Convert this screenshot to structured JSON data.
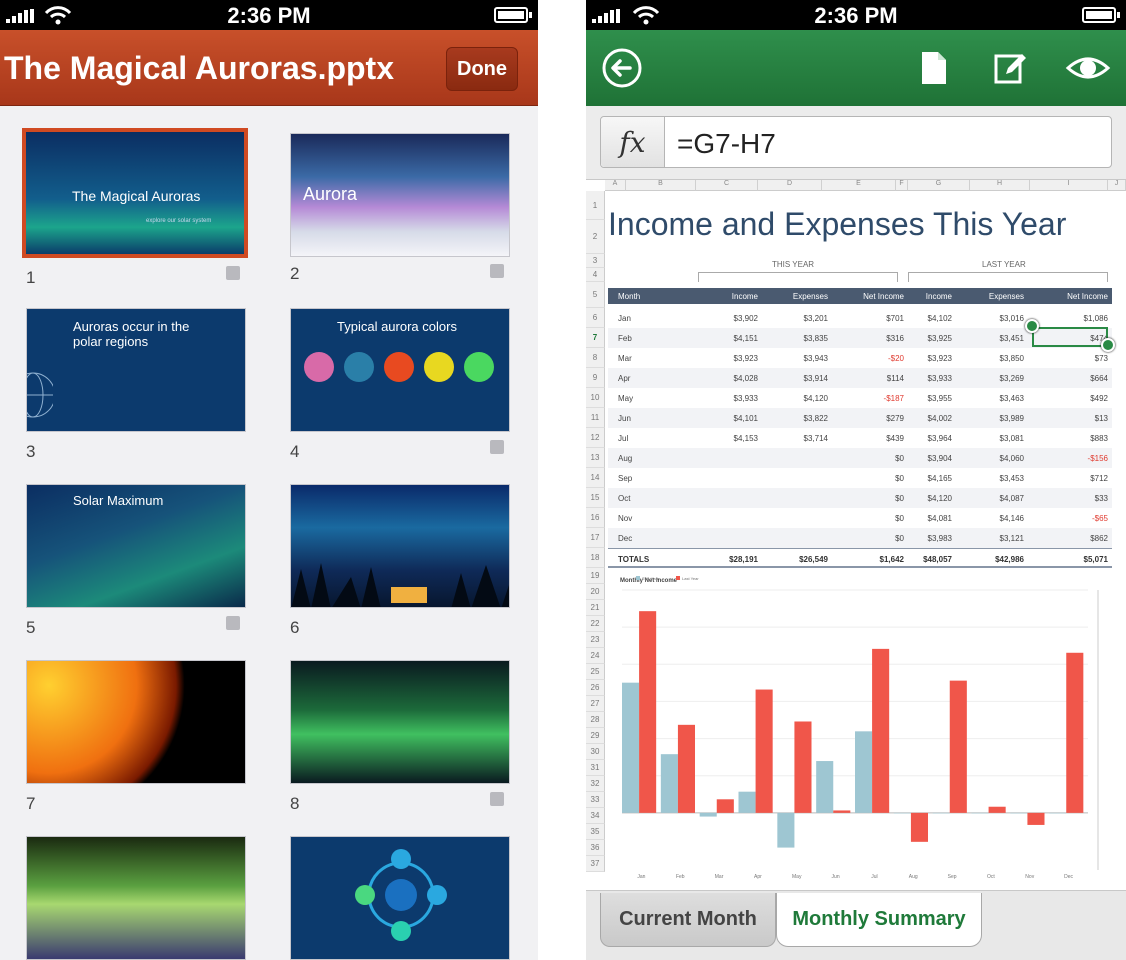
{
  "status": {
    "time": "2:36 PM"
  },
  "ppt": {
    "title": "The Magical Auroras.pptx",
    "done_label": "Done",
    "slides": [
      {
        "num": "1",
        "title": "The Magical Auroras",
        "subtitle": "explore our solar system"
      },
      {
        "num": "2",
        "title": "Aurora"
      },
      {
        "num": "3",
        "title": "Auroras occur in the polar regions"
      },
      {
        "num": "4",
        "title": "Typical aurora colors"
      },
      {
        "num": "5",
        "title": "Solar Maximum"
      },
      {
        "num": "6"
      },
      {
        "num": "7"
      },
      {
        "num": "8"
      }
    ]
  },
  "excel": {
    "formula_prefix": "fx",
    "formula": "=G7-H7",
    "sheet_title": "Income and Expenses This Year",
    "this_year_label": "THIS YEAR",
    "last_year_label": "LAST YEAR",
    "columns": [
      "A",
      "B",
      "C",
      "D",
      "E",
      "F",
      "G",
      "H",
      "I",
      "J"
    ],
    "row_numbers": [
      "1",
      "2",
      "3",
      "4",
      "5",
      "6",
      "7",
      "8",
      "9",
      "10",
      "11",
      "12",
      "13",
      "14",
      "15",
      "16",
      "17",
      "18",
      "19",
      "20",
      "21",
      "22",
      "23",
      "24",
      "25",
      "26",
      "27",
      "28",
      "29",
      "30",
      "31",
      "32",
      "33",
      "34",
      "35",
      "36",
      "37"
    ],
    "headers": [
      "Month",
      "Income",
      "Expenses",
      "Net Income",
      "Income",
      "Expenses",
      "Net Income"
    ],
    "rows": [
      [
        "Jan",
        "$3,902",
        "$3,201",
        "$701",
        "$4,102",
        "$3,016",
        "$1,086"
      ],
      [
        "Feb",
        "$4,151",
        "$3,835",
        "$316",
        "$3,925",
        "$3,451",
        "$474"
      ],
      [
        "Mar",
        "$3,923",
        "$3,943",
        "-$20",
        "$3,923",
        "$3,850",
        "$73"
      ],
      [
        "Apr",
        "$4,028",
        "$3,914",
        "$114",
        "$3,933",
        "$3,269",
        "$664"
      ],
      [
        "May",
        "$3,933",
        "$4,120",
        "-$187",
        "$3,955",
        "$3,463",
        "$492"
      ],
      [
        "Jun",
        "$4,101",
        "$3,822",
        "$279",
        "$4,002",
        "$3,989",
        "$13"
      ],
      [
        "Jul",
        "$4,153",
        "$3,714",
        "$439",
        "$3,964",
        "$3,081",
        "$883"
      ],
      [
        "Aug",
        "",
        "",
        "$0",
        "$3,904",
        "$4,060",
        "-$156"
      ],
      [
        "Sep",
        "",
        "",
        "$0",
        "$4,165",
        "$3,453",
        "$712"
      ],
      [
        "Oct",
        "",
        "",
        "$0",
        "$4,120",
        "$4,087",
        "$33"
      ],
      [
        "Nov",
        "",
        "",
        "$0",
        "$4,081",
        "$4,146",
        "-$65"
      ],
      [
        "Dec",
        "",
        "",
        "$0",
        "$3,983",
        "$3,121",
        "$862"
      ]
    ],
    "totals": [
      "TOTALS",
      "$28,191",
      "$26,549",
      "$1,642",
      "$48,057",
      "$42,986",
      "$5,071"
    ],
    "tabs": {
      "current": "Current Month",
      "monthly": "Monthly Summary"
    },
    "colors": {
      "header_green": "#2f8f4c",
      "accent_red": "#f0564a",
      "accent_blue": "#9ec6d2"
    }
  },
  "chart_data": {
    "type": "bar",
    "title": "Monthly Net Income",
    "categories": [
      "Jan",
      "Feb",
      "Mar",
      "Apr",
      "May",
      "Jun",
      "Jul",
      "Aug",
      "Sep",
      "Oct",
      "Nov",
      "Dec"
    ],
    "series": [
      {
        "name": "This Year",
        "values": [
          701,
          316,
          -20,
          114,
          -187,
          279,
          439,
          0,
          0,
          0,
          0,
          0
        ]
      },
      {
        "name": "Last Year",
        "values": [
          1086,
          474,
          73,
          664,
          492,
          13,
          883,
          -156,
          712,
          33,
          -65,
          862
        ]
      }
    ],
    "ylim": [
      -200,
      1200
    ]
  }
}
